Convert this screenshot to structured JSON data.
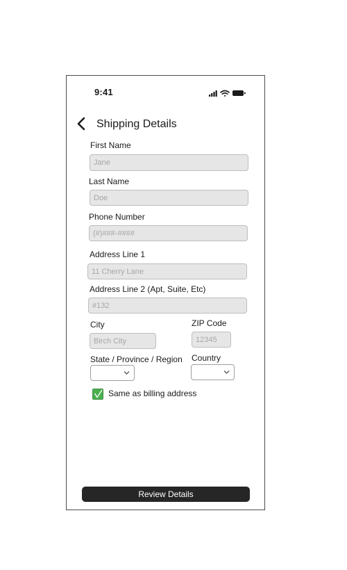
{
  "status_bar": {
    "time": "9:41",
    "icons": [
      "signal-icon",
      "wifi-icon",
      "battery-icon"
    ]
  },
  "header": {
    "back_icon": "chevron-left-icon",
    "title": "Shipping Details"
  },
  "form": {
    "first_name": {
      "label": "First Name",
      "placeholder": "Jane"
    },
    "last_name": {
      "label": "Last Name",
      "placeholder": "Doe"
    },
    "phone": {
      "label": "Phone Number",
      "placeholder": "(#)###-####"
    },
    "address1": {
      "label": "Address Line 1",
      "placeholder": "11 Cherry Lane"
    },
    "address2": {
      "label": "Address Line 2 (Apt, Suite, Etc)",
      "placeholder": "#132"
    },
    "city": {
      "label": "City",
      "placeholder": "Birch City"
    },
    "zip": {
      "label": "ZIP Code",
      "placeholder": "12345"
    },
    "state": {
      "label": "State / Province / Region",
      "selected": ""
    },
    "country": {
      "label": "Country",
      "selected": ""
    },
    "same_as_billing": {
      "label": "Same as billing address",
      "checked": true
    }
  },
  "footer": {
    "review_label": "Review Details"
  },
  "colors": {
    "checkbox": "#4caf50",
    "button": "#262626",
    "field_bg": "#e6e6e6"
  }
}
